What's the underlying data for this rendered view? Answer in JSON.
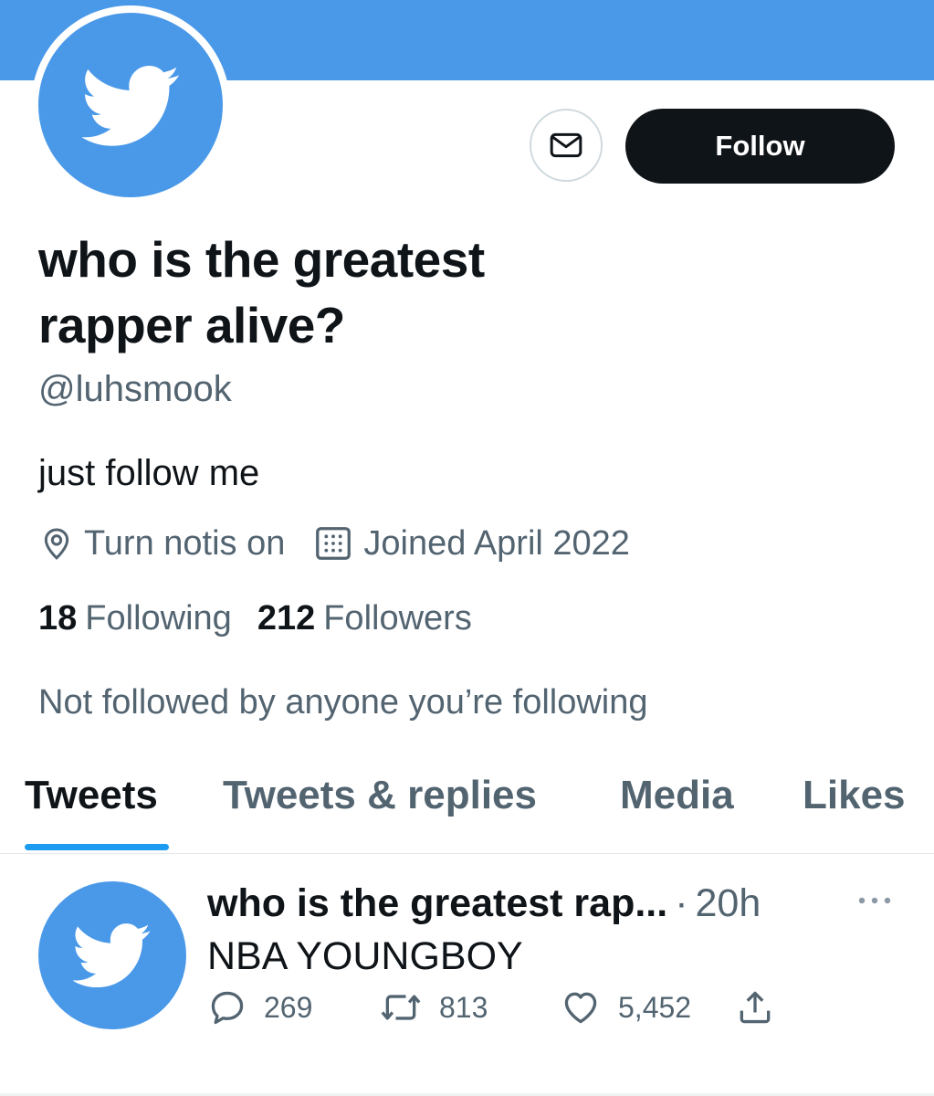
{
  "profile": {
    "display_name": "who is the greatest rapper alive?",
    "handle": "@luhsmook",
    "bio": "just follow me",
    "location": "Turn notis on",
    "joined": "Joined April 2022",
    "following_count": "18",
    "following_label": "Following",
    "followers_count": "212",
    "followers_label": "Followers",
    "not_followed": "Not followed by anyone you’re following"
  },
  "actions": {
    "follow_label": "Follow"
  },
  "tabs": [
    {
      "label": "Tweets",
      "active": true
    },
    {
      "label": "Tweets & replies",
      "active": false
    },
    {
      "label": "Media",
      "active": false
    },
    {
      "label": "Likes",
      "active": false
    }
  ],
  "tweet": {
    "author": "who is the greatest rap...",
    "separator": "·",
    "time": "20h",
    "text": "NBA YOUNGBOY",
    "replies": "269",
    "retweets": "813",
    "likes": "5,452"
  },
  "icons": {
    "avatar": "twitter-bird-icon",
    "message": "envelope-icon",
    "location": "location-pin-icon",
    "joined": "calendar-icon",
    "reply": "reply-bubble-icon",
    "retweet": "retweet-icon",
    "like": "heart-icon",
    "share": "share-icon",
    "more": "more-dots-icon"
  },
  "colors": {
    "accent": "#1d9bf0",
    "avatar_blue": "#4a99e9",
    "text_primary": "#0f1419",
    "text_secondary": "#536471"
  }
}
